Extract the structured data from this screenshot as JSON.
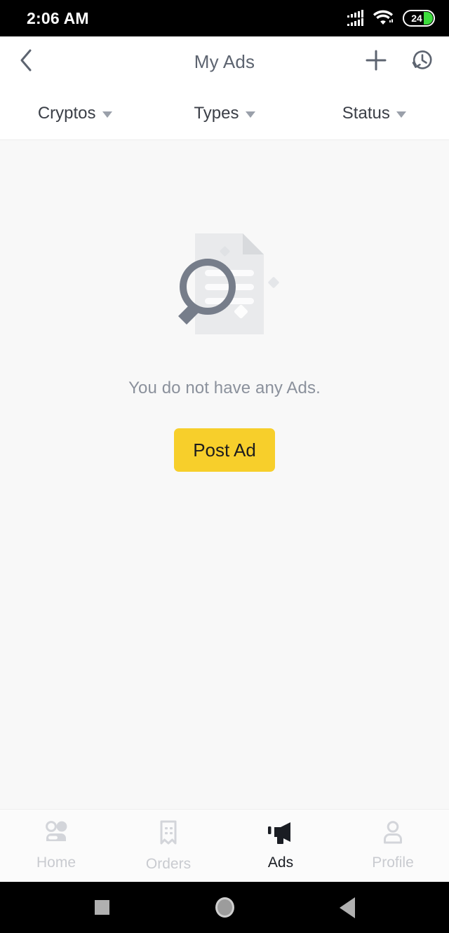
{
  "status_bar": {
    "time": "2:06 AM",
    "signal_icon": "cellular-signal-icon",
    "wifi_icon": "wifi-icon",
    "battery_level": "24",
    "battery_fill_color": "#3ddc3d"
  },
  "app_bar": {
    "back_icon": "back-chevron-icon",
    "title": "My Ads",
    "add_icon": "plus-icon",
    "history_icon": "history-icon"
  },
  "filters": [
    {
      "label": "Cryptos",
      "caret_icon": "chevron-down-icon"
    },
    {
      "label": "Types",
      "caret_icon": "chevron-down-icon"
    },
    {
      "label": "Status",
      "caret_icon": "chevron-down-icon"
    }
  ],
  "empty_state": {
    "illustration_icon": "document-search-illustration",
    "message": "You do not have any Ads.",
    "button_label": "Post Ad",
    "button_color": "#f7cf2b",
    "message_color": "#8b919c"
  },
  "bottom_nav": {
    "items": [
      {
        "label": "Home",
        "icon": "people-icon",
        "active": false
      },
      {
        "label": "Orders",
        "icon": "receipt-icon",
        "active": false
      },
      {
        "label": "Ads",
        "icon": "megaphone-icon",
        "active": true
      },
      {
        "label": "Profile",
        "icon": "person-icon",
        "active": false
      }
    ],
    "active_color": "#1a1d23",
    "inactive_color": "#c9cbd0"
  },
  "system_nav": {
    "recents_icon": "square-recents-icon",
    "home_icon": "circle-home-icon",
    "back_icon": "triangle-back-icon"
  }
}
